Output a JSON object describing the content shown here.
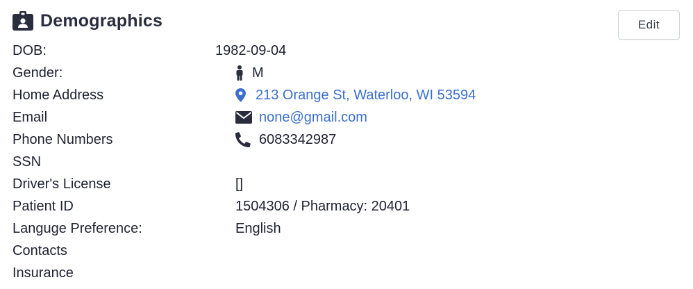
{
  "header": {
    "title": "Demographics",
    "icon": "id-badge-icon",
    "edit_label": "Edit"
  },
  "colors": {
    "link": "#3a6fd0",
    "icon_dark": "#2a2d3e"
  },
  "fields": {
    "dob": {
      "label": "DOB:",
      "value": "1982-09-04"
    },
    "gender": {
      "label": "Gender:",
      "value": "M",
      "icon": "male-icon"
    },
    "address": {
      "label": "Home Address",
      "value": "213 Orange St, Waterloo, WI 53594",
      "icon": "map-marker-icon"
    },
    "email": {
      "label": "Email",
      "value": "none@gmail.com",
      "icon": "envelope-icon"
    },
    "phone": {
      "label": "Phone Numbers",
      "value": "6083342987",
      "icon": "phone-icon"
    },
    "ssn": {
      "label": "SSN",
      "value": ""
    },
    "license": {
      "label": "Driver's License",
      "value": "[]"
    },
    "patient_id": {
      "label": "Patient ID",
      "value": "1504306 / Pharmacy: 20401"
    },
    "language": {
      "label": "Languge Preference:",
      "value": "English"
    },
    "contacts": {
      "label": "Contacts"
    },
    "insurance": {
      "label": "Insurance"
    }
  }
}
